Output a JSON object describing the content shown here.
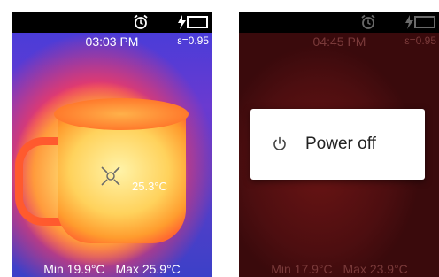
{
  "left_screen": {
    "time": "03:03 PM",
    "emissivity": "ε=0.95",
    "spot_temperature": "25.3°C",
    "min_label": "Min 19.9°C",
    "max_label": "Max 25.9°C"
  },
  "right_screen": {
    "time": "04:45 PM",
    "emissivity": "ε=0.95",
    "min_label": "Min 17.9°C",
    "max_label": "Max 23.9°C",
    "dialog": {
      "power_off_label": "Power off",
      "icon": "power-icon"
    }
  },
  "colors": {
    "dialog_bg": "#ffffff",
    "overlay_tint": "#4b0e10"
  }
}
